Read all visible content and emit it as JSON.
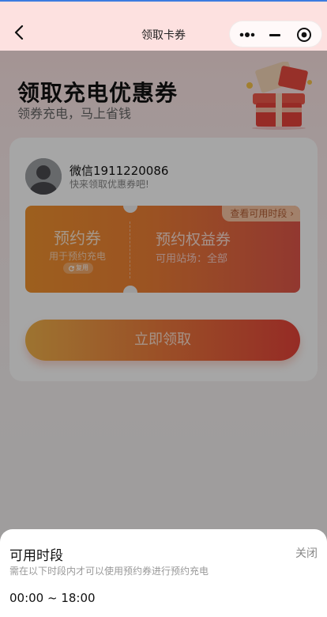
{
  "nav": {
    "title": "领取卡券",
    "back_icon": "chevron-left-icon",
    "capsule": {
      "more_icon": "more-dots-icon",
      "minimize_icon": "minimize-icon",
      "close_icon": "target-circle-icon"
    }
  },
  "hero": {
    "title": "领取充电优惠券",
    "subtitle": "领券充电，马上省钱",
    "gift_icon": "gift-box-icon"
  },
  "user": {
    "name": "微信1911220086",
    "tip": "快来领取优惠券吧!"
  },
  "coupon": {
    "type_title": "预约券",
    "type_desc": "用于预约充电",
    "reuse_badge": "复用",
    "benefit_title": "预约权益券",
    "benefit_desc": "可用站场：全部",
    "view_periods": "查看可用时段 ›"
  },
  "claim_button": "立即领取",
  "sheet": {
    "title": "可用时段",
    "close": "关闭",
    "desc": "需在以下时段内才可以使用预约券进行预约充电",
    "time_range": "00:00 ~ 18:00"
  },
  "colors": {
    "accent": "#ee7a3c",
    "coupon_start": "#f2932f",
    "coupon_end": "#e0564a"
  }
}
